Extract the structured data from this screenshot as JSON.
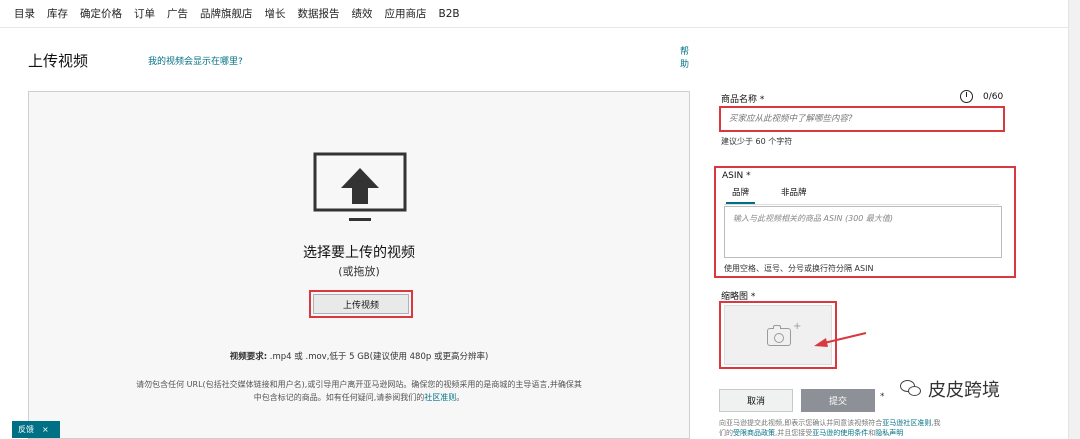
{
  "nav": {
    "items": [
      "目录",
      "库存",
      "确定价格",
      "订单",
      "广告",
      "品牌旗舰店",
      "增长",
      "数据报告",
      "绩效",
      "应用商店",
      "B2B"
    ]
  },
  "page": {
    "title": "上传视频",
    "where_link": "我的视频会显示在哪里?",
    "help": "帮助"
  },
  "upload": {
    "choose_text": "选择要上传的视频",
    "drag_text": "(或拖放)",
    "button_label": "上传视频",
    "req_label": "视频要求:",
    "req_text": ".mp4 或 .mov,低于 5 GB(建议使用 480p 或更高分辨率)",
    "policy_line1": "请勿包含任何 URL(包括社交媒体链接和用户名),或引导用户离开亚马逊网站。确保您的视频采用的是商城的主导语言,并确保其",
    "policy_line2_a": "中包含标记的商品。如有任何疑问,请参阅我们的",
    "policy_link": "社区准则",
    "policy_end": "。"
  },
  "feedback": {
    "label": "反馈",
    "close": "×"
  },
  "product_name": {
    "label": "商品名称 *",
    "counter": "0/60",
    "placeholder": "买家应从此视频中了解哪些内容?",
    "hint": "建议少于 60 个字符"
  },
  "asin": {
    "label": "ASIN *",
    "tabs": [
      "品牌",
      "非品牌"
    ],
    "placeholder": "输入与此视频相关的商品 ASIN (300 最大值)",
    "hint": "使用空格、逗号、分号或换行符分隔 ASIN"
  },
  "thumbnail": {
    "label": "缩略图 *",
    "plus": "+"
  },
  "actions": {
    "cancel": "取消",
    "submit": "提交"
  },
  "footer": {
    "line1_a": "向亚马逊提交此视频,即表示您确认并同意该视频符合",
    "line1_link": "亚马逊社区准则",
    "line1_b": ",我",
    "line2_a": "们的",
    "line2_link1": "受限商品政策",
    "line2_b": ",并且您接受",
    "line2_link2": "亚马逊的使用条件",
    "line2_c": "和",
    "line2_link3": "隐私声明"
  },
  "watermark": {
    "text": "皮皮跨境",
    "small": "*"
  }
}
